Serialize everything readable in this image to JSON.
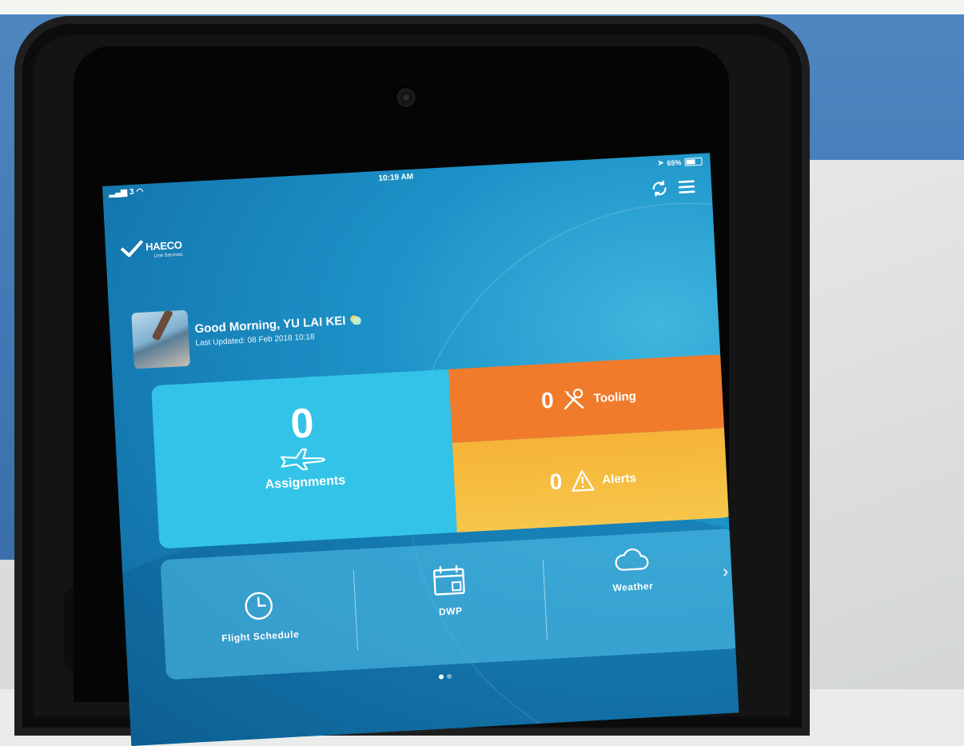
{
  "status_bar": {
    "carrier": "3",
    "time": "10:19 AM",
    "battery": "65%"
  },
  "header": {
    "refresh_icon": "refresh-icon",
    "menu_icon": "hamburger-menu-icon"
  },
  "logo": {
    "name": "HAECO",
    "sub": "Line Services"
  },
  "greeting": {
    "title": "Good Morning, YU LAI KEI",
    "last_updated": "Last Updated: 08 Feb 2018 10:18",
    "weather_icon": "partly-sunny-icon"
  },
  "tiles": {
    "assignments": {
      "count": "0",
      "label": "Assignments",
      "icon": "airplane-icon",
      "color": "#33c3e8"
    },
    "tooling": {
      "count": "0",
      "label": "Tooling",
      "icon": "tools-icon",
      "color": "#f07b2b"
    },
    "alerts": {
      "count": "0",
      "label": "Alerts",
      "icon": "warning-icon",
      "color": "#f6b437"
    }
  },
  "quick_menu": {
    "items": [
      {
        "label": "Flight Schedule",
        "icon": "clock-icon"
      },
      {
        "label": "DWP",
        "icon": "calendar-icon"
      },
      {
        "label": "Weather",
        "icon": "cloud-icon"
      }
    ],
    "next_icon": "chevron-right-icon"
  },
  "pager": {
    "pages": 2,
    "current": 1
  }
}
